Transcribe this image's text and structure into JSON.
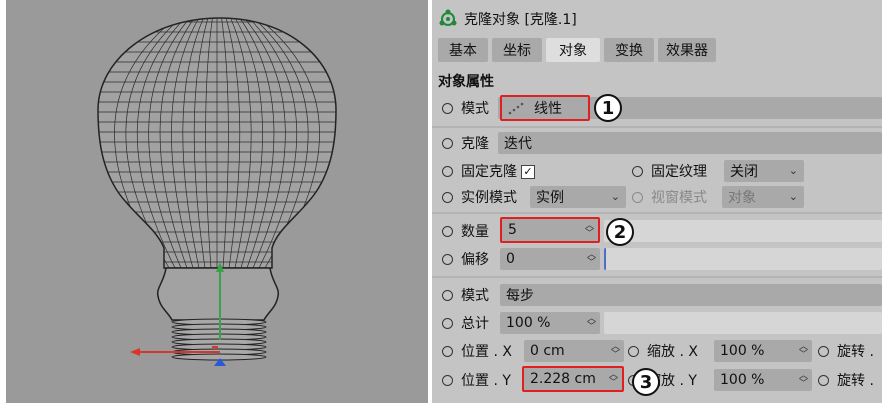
{
  "header": {
    "title": "克隆对象 [克隆.1]"
  },
  "tabs": [
    "基本",
    "坐标",
    "对象",
    "变换",
    "效果器"
  ],
  "section_title": "对象属性",
  "mode": {
    "label": "模式",
    "value": "线性",
    "callout": "1"
  },
  "clone": {
    "label": "克隆",
    "value": "迭代"
  },
  "fix_clone": {
    "label": "固定克隆",
    "checked": "✓"
  },
  "fix_texture": {
    "label": "固定纹理",
    "value": "关闭"
  },
  "instance_mode": {
    "label": "实例模式",
    "value": "实例"
  },
  "viewport_mode": {
    "label": "视窗模式",
    "value": "对象"
  },
  "count": {
    "label": "数量",
    "value": "5",
    "callout": "2"
  },
  "offset": {
    "label": "偏移",
    "value": "0"
  },
  "mode2": {
    "label": "模式",
    "value": "每步"
  },
  "total": {
    "label": "总计",
    "value": "100 %"
  },
  "pos_x": {
    "label": "位置 . X",
    "value": "0 cm"
  },
  "scale_x": {
    "label": "缩放 . X",
    "value": "100 %"
  },
  "rot_x": {
    "label": "旋转 ."
  },
  "pos_y": {
    "label": "位置 . Y",
    "value": "2.228 cm",
    "callout": "3"
  },
  "scale_y": {
    "label": "缩放 . Y",
    "value": "100 %"
  },
  "rot_y": {
    "label": "旋转 ."
  },
  "colors": {
    "accent_red": "#e02020",
    "viewport_bg": "#9a9a9a",
    "panel_bg": "#c4c4c4"
  }
}
